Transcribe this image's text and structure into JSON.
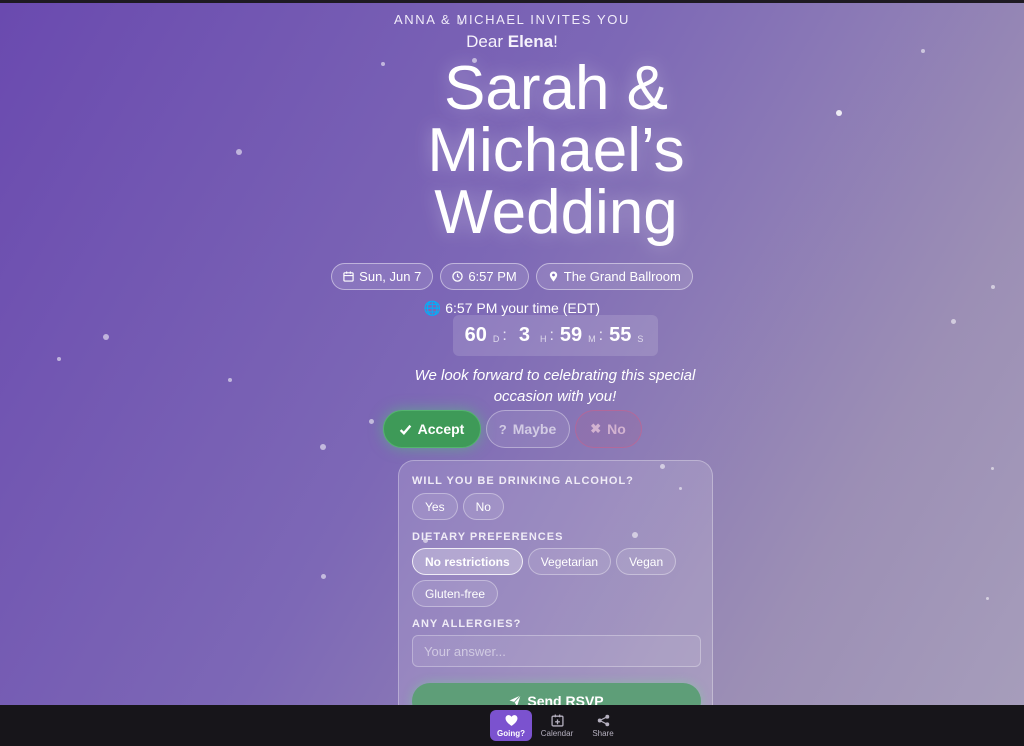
{
  "header": {
    "invites": "ANNA & MICHAEL INVITES YOU",
    "dear_prefix": "Dear ",
    "guest_name": "Elena",
    "dear_suffix": "!",
    "title": "Sarah & Michael’s Wedding"
  },
  "details": {
    "date": "Sun, Jun 7",
    "time": "6:57 PM",
    "venue": "The Grand Ballroom",
    "local_time": "🌐 6:57 PM your time (EDT)"
  },
  "countdown": {
    "days": "60",
    "days_unit": "D",
    "hours": "3",
    "hours_unit": "H",
    "minutes": "59",
    "minutes_unit": "M",
    "seconds": "55",
    "seconds_unit": "S"
  },
  "message": "We look forward to celebrating this special occasion with you!",
  "rsvp": {
    "accept": "Accept",
    "maybe": "Maybe",
    "no": "No"
  },
  "form": {
    "q_alcohol": "WILL YOU BE DRINKING ALCOHOL?",
    "alcohol_options": [
      "Yes",
      "No"
    ],
    "q_diet": "DIETARY PREFERENCES",
    "diet_options": [
      "No restrictions",
      "Vegetarian",
      "Vegan",
      "Gluten-free"
    ],
    "diet_selected": "No restrictions",
    "q_allergies": "ANY ALLERGIES?",
    "allergies_placeholder": "Your answer...",
    "allergies_value": "",
    "send": "Send RSVP"
  },
  "nav": {
    "going": "Going?",
    "calendar": "Calendar",
    "share": "Share"
  },
  "colors": {
    "accent": "#7b52cf",
    "accept": "#3e9a58",
    "send": "#5e9e78"
  }
}
